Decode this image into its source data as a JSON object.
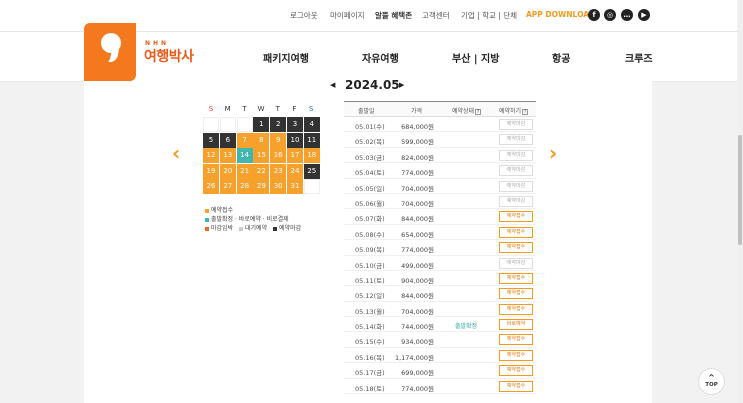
{
  "topbar": {
    "logout": "로그아웃",
    "mypage": "마이페이지",
    "benefits": "알뜰 혜택존",
    "customer_center": "고객센터",
    "business": "기업 | 학교 | 단체",
    "app_download": "APP DOWNLOAD",
    "sns": [
      "facebook-icon",
      "instagram-icon",
      "talk-icon",
      "youtube-icon"
    ]
  },
  "logo": {
    "sub": "NHN",
    "name": "여행박사"
  },
  "menu": [
    "패키지여행",
    "자유여행",
    "부산 | 지방",
    "항공",
    "크루즈"
  ],
  "calendar": {
    "month_label": "2024.05",
    "weekdays": [
      "S",
      "M",
      "T",
      "W",
      "T",
      "F",
      "S"
    ],
    "weeks": [
      [
        "",
        "",
        "",
        "1",
        "2",
        "3",
        "4"
      ],
      [
        "5",
        "6",
        "7",
        "8",
        "9",
        "10",
        "11"
      ],
      [
        "12",
        "13",
        "14",
        "15",
        "16",
        "17",
        "18"
      ],
      [
        "19",
        "20",
        "21",
        "22",
        "23",
        "24",
        "25"
      ],
      [
        "26",
        "27",
        "28",
        "29",
        "30",
        "31",
        ""
      ]
    ],
    "states": [
      [
        "w",
        "w",
        "w",
        "d",
        "d",
        "d",
        "d"
      ],
      [
        "d",
        "d",
        "o",
        "o",
        "o",
        "d",
        "d"
      ],
      [
        "o",
        "o",
        "t",
        "o",
        "o",
        "o",
        "o"
      ],
      [
        "o",
        "o",
        "o",
        "o",
        "o",
        "o",
        "d"
      ],
      [
        "o",
        "o",
        "o",
        "o",
        "o",
        "o",
        "w"
      ]
    ]
  },
  "legend": {
    "line1": "예약접수",
    "line2": "출발확정 · 바로예약 · 비로결제",
    "line3a": "마감임박",
    "line3b": "대기예약",
    "line3c": "예약마감"
  },
  "colors": {
    "orange": "#f5a12b",
    "dark": "#333333",
    "teal": "#3fb7ae",
    "accent": "#f39a1f"
  },
  "table": {
    "headers": {
      "date": "출발일",
      "price": "가격",
      "status": "예약상태",
      "action": "예약하기"
    },
    "rows": [
      {
        "date": "05.01(수)",
        "price": "684,000원",
        "status": "",
        "btn": "예약마감",
        "on": false
      },
      {
        "date": "05.02(목)",
        "price": "599,000원",
        "status": "",
        "btn": "예약마감",
        "on": false
      },
      {
        "date": "05.03(금)",
        "price": "824,000원",
        "status": "",
        "btn": "예약마감",
        "on": false
      },
      {
        "date": "05.04(토)",
        "price": "774,000원",
        "status": "",
        "btn": "예약마감",
        "on": false
      },
      {
        "date": "05.05(일)",
        "price": "704,000원",
        "status": "",
        "btn": "예약마감",
        "on": false
      },
      {
        "date": "05.06(월)",
        "price": "704,000원",
        "status": "",
        "btn": "예약마감",
        "on": false
      },
      {
        "date": "05.07(화)",
        "price": "844,000원",
        "status": "",
        "btn": "예약접수",
        "on": true
      },
      {
        "date": "05.08(수)",
        "price": "654,000원",
        "status": "",
        "btn": "예약접수",
        "on": true
      },
      {
        "date": "05.09(목)",
        "price": "774,000원",
        "status": "",
        "btn": "예약접수",
        "on": true
      },
      {
        "date": "05.10(금)",
        "price": "499,000원",
        "status": "",
        "btn": "예약마감",
        "on": false
      },
      {
        "date": "05.11(토)",
        "price": "904,000원",
        "status": "",
        "btn": "예약접수",
        "on": true
      },
      {
        "date": "05.12(일)",
        "price": "844,000원",
        "status": "",
        "btn": "예약접수",
        "on": true
      },
      {
        "date": "05.13(월)",
        "price": "704,000원",
        "status": "",
        "btn": "예약접수",
        "on": true
      },
      {
        "date": "05.14(화)",
        "price": "744,000원",
        "status": "출발확정",
        "btn": "바로예약",
        "on": true
      },
      {
        "date": "05.15(수)",
        "price": "934,000원",
        "status": "",
        "btn": "예약접수",
        "on": true
      },
      {
        "date": "05.16(목)",
        "price": "1,174,000원",
        "status": "",
        "btn": "예약접수",
        "on": true
      },
      {
        "date": "05.17(금)",
        "price": "699,000원",
        "status": "",
        "btn": "예약접수",
        "on": true
      },
      {
        "date": "05.18(토)",
        "price": "774,000원",
        "status": "",
        "btn": "예약접수",
        "on": true
      }
    ]
  },
  "top_button": "TOP"
}
